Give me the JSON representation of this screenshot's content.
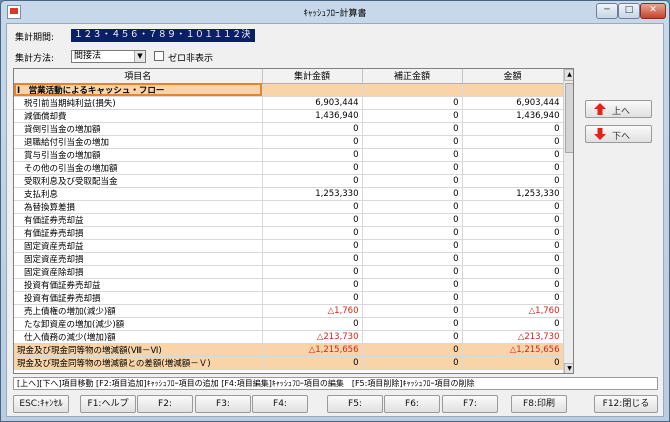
{
  "window": {
    "title": "ｷｬｯｼｭﾌﾛｰ計算書",
    "min_label": "─",
    "max_label": "□",
    "close_label": "✕"
  },
  "filters": {
    "period_label": "集計期間:",
    "period_value": "１２３・４５６・７８９・１０１１１２決",
    "method_label": "集計方法:",
    "method_value": "間接法",
    "zero_hide_label": "ゼロ非表示",
    "zero_hide_checked": false
  },
  "table": {
    "headers": [
      "項目名",
      "集計金額",
      "補正金額",
      "金額"
    ],
    "rows": [
      {
        "type": "section",
        "name": "Ⅰ　営業活動によるキャッシュ・フロー",
        "total": "",
        "adjust": "",
        "amount": ""
      },
      {
        "type": "sub",
        "name": "税引前当期純利益(損失)",
        "total": "6,903,444",
        "adjust": "0",
        "amount": "6,903,444"
      },
      {
        "type": "sub",
        "name": "減価償却費",
        "total": "1,436,940",
        "adjust": "0",
        "amount": "1,436,940"
      },
      {
        "type": "sub",
        "name": "貸倒引当金の増加額",
        "total": "0",
        "adjust": "0",
        "amount": "0"
      },
      {
        "type": "sub",
        "name": "退職給付引当金の増加",
        "total": "0",
        "adjust": "0",
        "amount": "0"
      },
      {
        "type": "sub",
        "name": "賞与引当金の増加額",
        "total": "0",
        "adjust": "0",
        "amount": "0"
      },
      {
        "type": "sub",
        "name": "その他の引当金の増加額",
        "total": "0",
        "adjust": "0",
        "amount": "0"
      },
      {
        "type": "sub",
        "name": "受取利息及び受取配当金",
        "total": "0",
        "adjust": "0",
        "amount": "0"
      },
      {
        "type": "sub",
        "name": "支払利息",
        "total": "1,253,330",
        "adjust": "0",
        "amount": "1,253,330"
      },
      {
        "type": "sub",
        "name": "為替換算差損",
        "total": "0",
        "adjust": "0",
        "amount": "0"
      },
      {
        "type": "sub",
        "name": "有価証券売却益",
        "total": "0",
        "adjust": "0",
        "amount": "0"
      },
      {
        "type": "sub",
        "name": "有価証券売却損",
        "total": "0",
        "adjust": "0",
        "amount": "0"
      },
      {
        "type": "sub",
        "name": "固定資産売却益",
        "total": "0",
        "adjust": "0",
        "amount": "0"
      },
      {
        "type": "sub",
        "name": "固定資産売却損",
        "total": "0",
        "adjust": "0",
        "amount": "0"
      },
      {
        "type": "sub",
        "name": "固定資産除却損",
        "total": "0",
        "adjust": "0",
        "amount": "0"
      },
      {
        "type": "sub",
        "name": "投資有価証券売却益",
        "total": "0",
        "adjust": "0",
        "amount": "0"
      },
      {
        "type": "sub",
        "name": "投資有価証券売却損",
        "total": "0",
        "adjust": "0",
        "amount": "0"
      },
      {
        "type": "sub",
        "name": "売上債権の増加(減少)額",
        "total": "△1,760",
        "adjust": "0",
        "amount": "△1,760",
        "negative": true
      },
      {
        "type": "sub",
        "name": "たな卸資産の増加(減少)額",
        "total": "0",
        "adjust": "0",
        "amount": "0"
      },
      {
        "type": "sub",
        "name": "仕入債務の減少(増加)額",
        "total": "△213,730",
        "adjust": "0",
        "amount": "△213,730",
        "negative": true
      },
      {
        "type": "total",
        "name": "現金及び現金同等物の増減額(Ⅷ－Ⅵ)",
        "total": "△1,215,656",
        "adjust": "0",
        "amount": "△1,215,656",
        "negative": true
      },
      {
        "type": "total",
        "name": "現金及び現金同等物の増減額との差額(増減額－Ｖ)",
        "total": "0",
        "adjust": "0",
        "amount": "0"
      }
    ]
  },
  "side": {
    "up_label": "上へ",
    "down_label": "下へ"
  },
  "status_message": "[上へ][下へ]項目移動 [F2:項目追加]ｷｬｯｼｭﾌﾛｰ項目の追加 [F4:項目編集]ｷｬｯｼｭﾌﾛｰ項目の編集　[F5:項目削除]ｷｬｯｼｭﾌﾛｰ項目の削除",
  "function_keys": [
    {
      "key": "esc",
      "label": "ESC:ｷｬﾝｾﾙ"
    },
    {
      "key": "f1",
      "label": "F1:ヘルプ"
    },
    {
      "key": "f2",
      "label": "F2:"
    },
    {
      "key": "f3",
      "label": "F3:"
    },
    {
      "key": "f4",
      "label": "F4:"
    },
    {
      "key": "f5",
      "label": "F5:"
    },
    {
      "key": "f6",
      "label": "F6:"
    },
    {
      "key": "f7",
      "label": "F7:"
    },
    {
      "key": "f8",
      "label": "F8:印刷"
    },
    {
      "key": "f12",
      "label": "F12:閉じる"
    }
  ],
  "colors": {
    "section_bg": "#f8d4a8",
    "negative_text": "#d8231a",
    "period_bg": "#0a1f66",
    "arrow_red": "#e0241b"
  }
}
